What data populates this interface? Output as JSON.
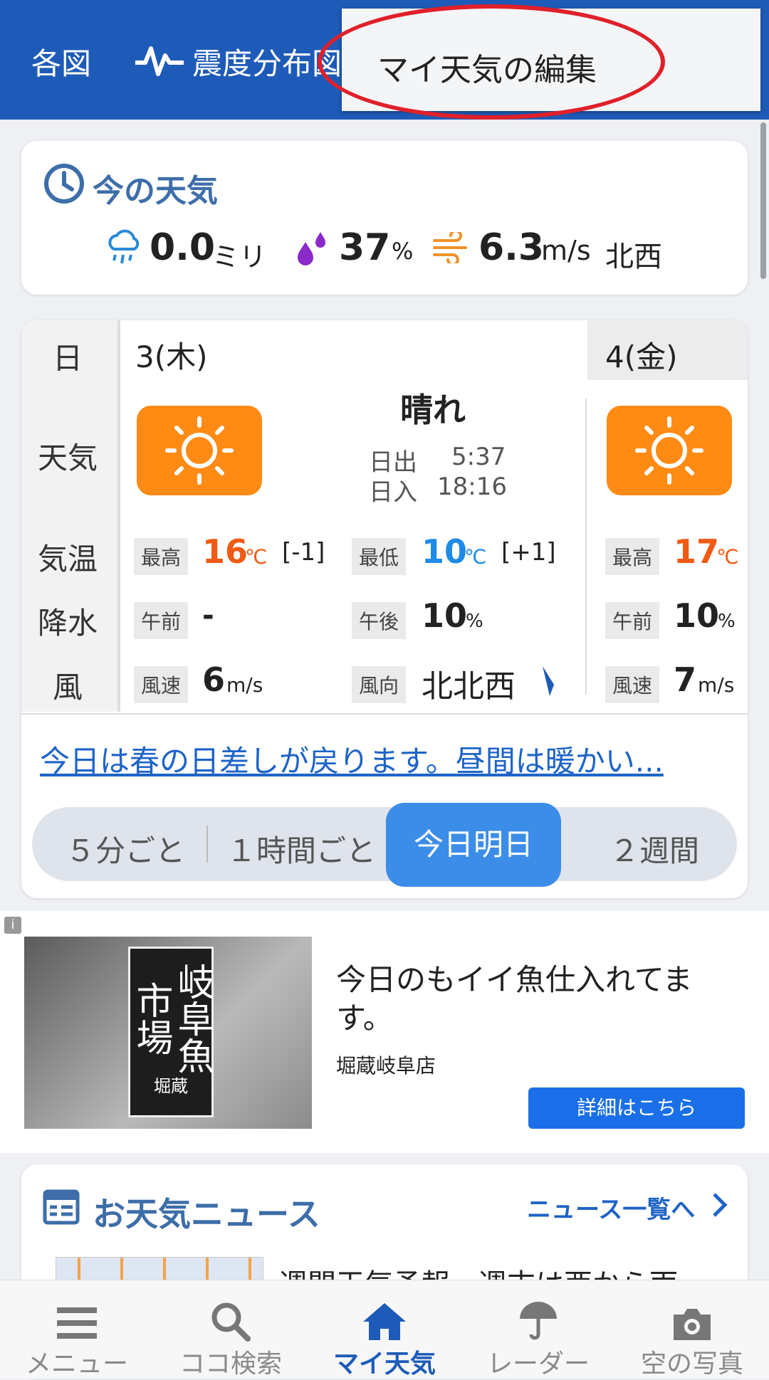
{
  "header": {
    "left_partial": "各図",
    "quake_label": "震度分布図",
    "menu_popup": "マイ天気の編集"
  },
  "now": {
    "title": "今の天気",
    "precip_value": "0.0",
    "precip_unit": "ミリ",
    "humidity_value": "37",
    "humidity_unit": "%",
    "wind_value": "6.3",
    "wind_unit": "m/s",
    "wind_dir": "北西"
  },
  "forecast": {
    "labels": {
      "day": "日",
      "weather": "天気",
      "temp": "気温",
      "precip": "降水",
      "wind": "風"
    },
    "today": {
      "date": "3(木)",
      "condition": "晴れ",
      "sunrise_label": "日出",
      "sunrise": "5:37",
      "sunset_label": "日入",
      "sunset": "18:16",
      "high_tag": "最高",
      "high": "16",
      "high_unit": "℃",
      "high_diff": "[-1]",
      "low_tag": "最低",
      "low": "10",
      "low_unit": "℃",
      "low_diff": "[+1]",
      "am_tag": "午前",
      "am": "-",
      "pm_tag": "午後",
      "pm": "10",
      "pm_unit": "%",
      "speed_tag": "風速",
      "speed": "6",
      "speed_unit": "m/s",
      "dir_tag": "風向",
      "dir": "北北西"
    },
    "tomorrow": {
      "date": "4(金)",
      "high_tag": "最高",
      "high": "17",
      "high_unit": "℃",
      "am_tag": "午前",
      "am": "10",
      "am_unit": "%",
      "speed_tag": "風速",
      "speed": "7",
      "speed_unit": "m/s"
    },
    "headline": "今日は春の日差しが戻ります。昼間は暖かい...",
    "tabs": [
      "５分ごと",
      "１時間ごと",
      "今日明日",
      "２週間"
    ],
    "active_tab": "今日明日"
  },
  "ad": {
    "badge": "岐阜魚市場",
    "badge_sub": "堀蔵",
    "headline": "今日のもイイ魚仕入れてます。",
    "shop": "堀蔵岐阜店",
    "button": "詳細はこちら"
  },
  "news": {
    "title": "お天気ニュース",
    "more": "ニュース一覧へ",
    "first_partial": "週間天気予報　週末は西から雨"
  },
  "bottom_nav": [
    {
      "label": "メニュー",
      "icon": "menu-icon"
    },
    {
      "label": "ココ検索",
      "icon": "search-icon"
    },
    {
      "label": "マイ天気",
      "icon": "home-icon"
    },
    {
      "label": "レーダー",
      "icon": "umbrella-icon"
    },
    {
      "label": "空の写真",
      "icon": "camera-icon"
    }
  ],
  "colors": {
    "header": "#1e5bb8",
    "accent": "#3c8de8",
    "high": "#f05a14",
    "low": "#1e8be6",
    "highlight": "#e0202a"
  }
}
